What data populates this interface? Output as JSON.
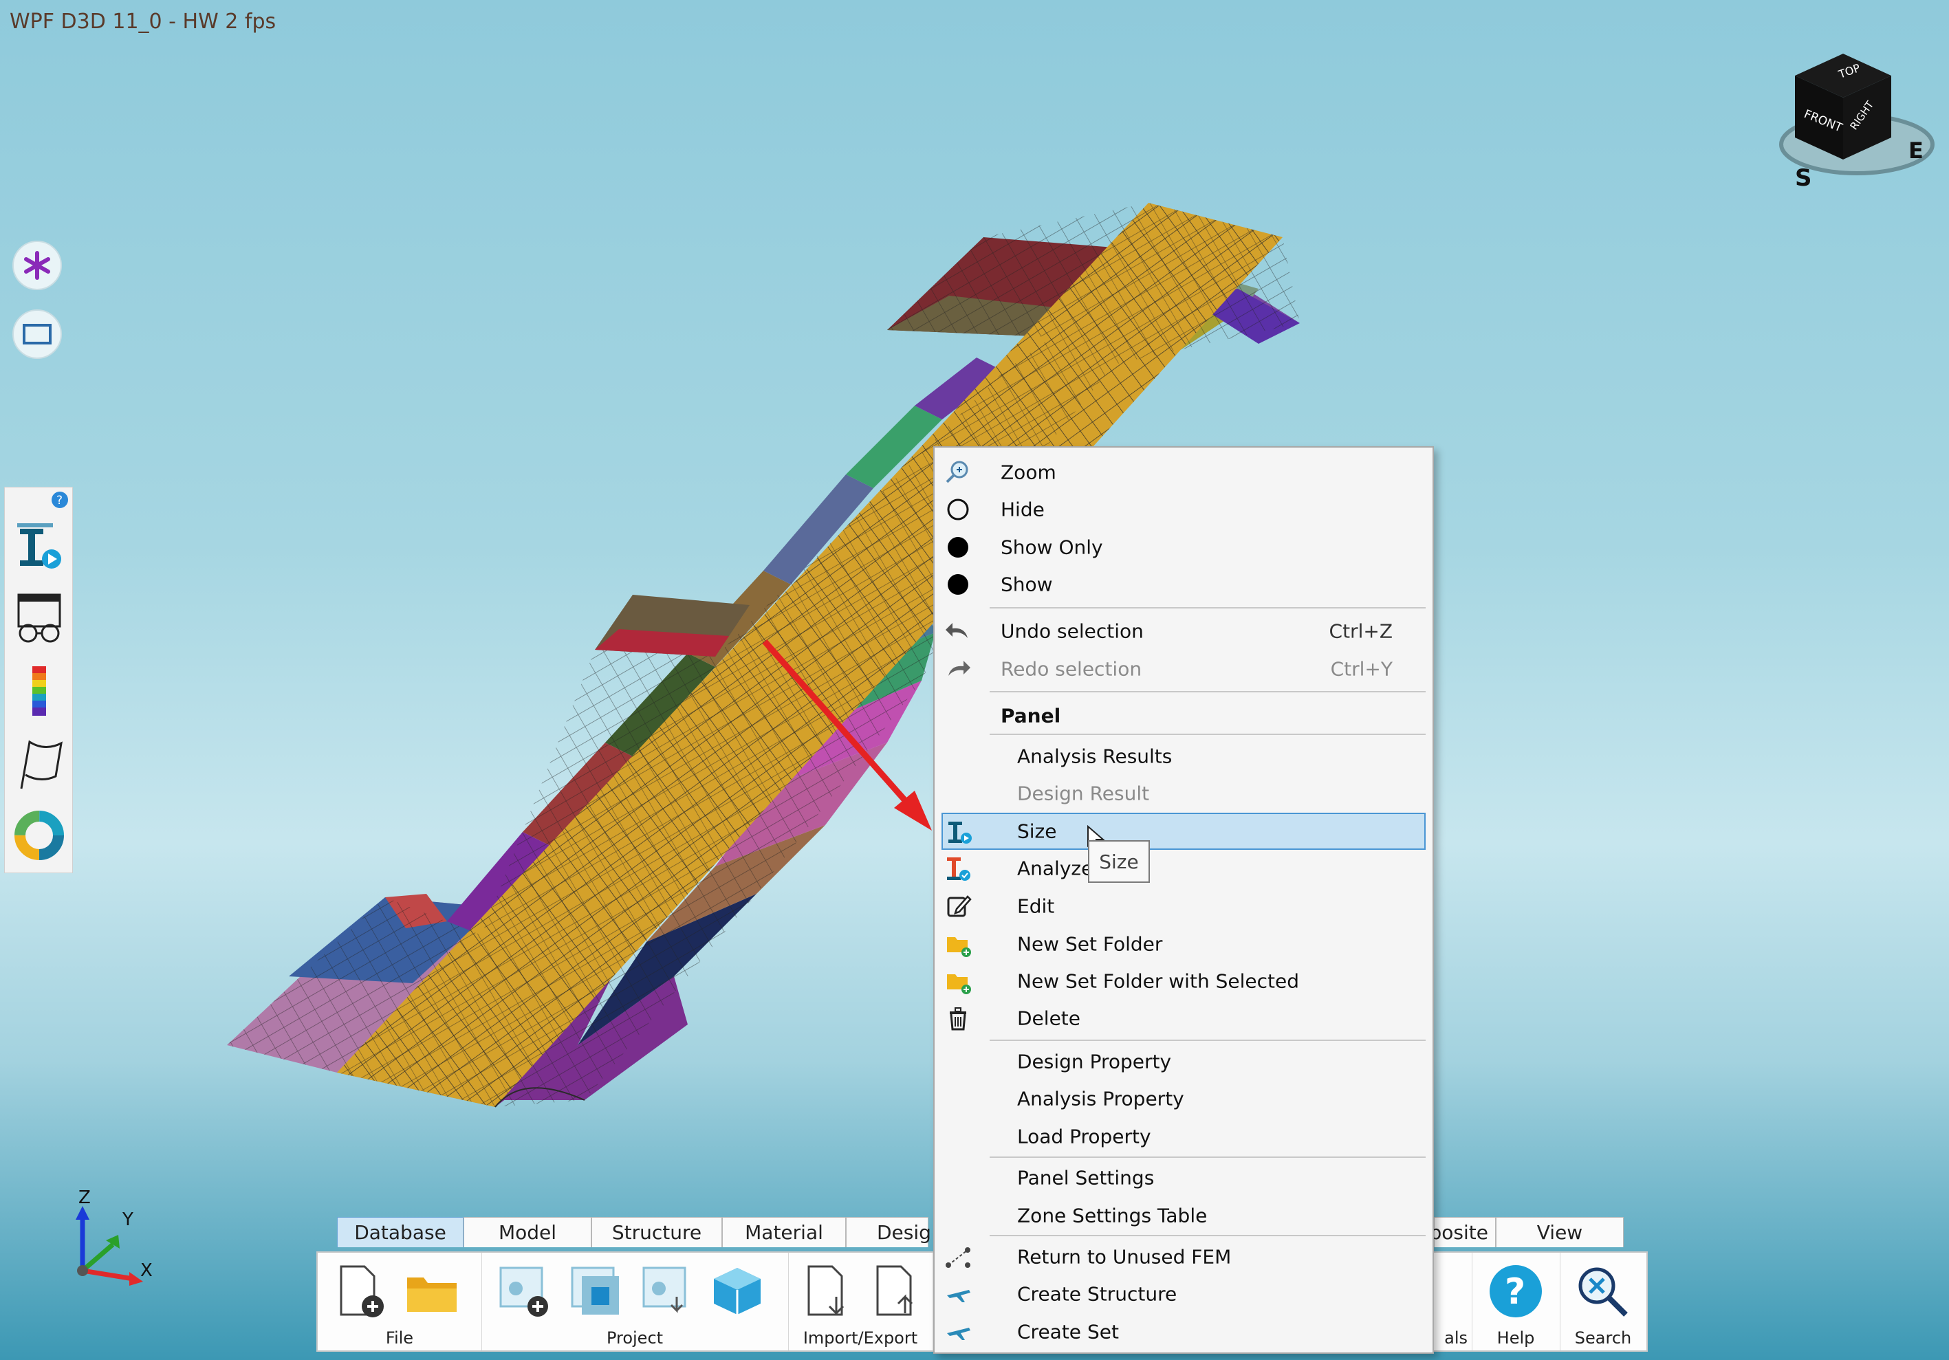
{
  "window": {
    "title": "WPF D3D 11_0 - HW 2 fps"
  },
  "nav_cube": {
    "top": "TOP",
    "front": "FRONT",
    "right": "RIGHT",
    "compass_s": "S",
    "compass_e": "E"
  },
  "axes": {
    "z": "Z",
    "y": "Y",
    "x": "X"
  },
  "side_tools": [
    "asterisk-icon",
    "rectangle-select-icon"
  ],
  "tool_strip": [
    "help-badge-icon",
    "size-panel-icon",
    "glasses-view-icon",
    "color-scale-icon",
    "flag-icon",
    "ring-chart-icon"
  ],
  "ribbon": {
    "tabs": [
      "Database",
      "Model",
      "Structure",
      "Material",
      "Desig",
      "posite",
      "View"
    ],
    "active_tab": "Database",
    "groups": {
      "file": "File",
      "project": "Project",
      "import_export": "Import/Export",
      "tutorials_partial": "als",
      "help": "Help",
      "search": "Search"
    }
  },
  "context_menu": {
    "items": {
      "zoom": "Zoom",
      "hide": "Hide",
      "show_only": "Show Only",
      "show": "Show",
      "undo": "Undo selection",
      "undo_shortcut": "Ctrl+Z",
      "redo": "Redo selection",
      "redo_shortcut": "Ctrl+Y",
      "panel_header": "Panel",
      "analysis_results": "Analysis Results",
      "design_result": "Design Result",
      "size": "Size",
      "analyze": "Analyze",
      "edit": "Edit",
      "new_set_folder": "New Set Folder",
      "new_set_folder_selected": "New Set Folder with Selected",
      "delete": "Delete",
      "design_property": "Design Property",
      "analysis_property": "Analysis Property",
      "load_property": "Load Property",
      "panel_settings": "Panel Settings",
      "zone_settings_table": "Zone Settings Table",
      "return_unused_fem": "Return to Unused FEM",
      "create_structure": "Create Structure",
      "create_set": "Create Set"
    },
    "tooltip": "Size"
  },
  "colors": {
    "accent": "#4a96d4",
    "wing_skin": "#d4a12a",
    "arrow": "#e52222"
  }
}
